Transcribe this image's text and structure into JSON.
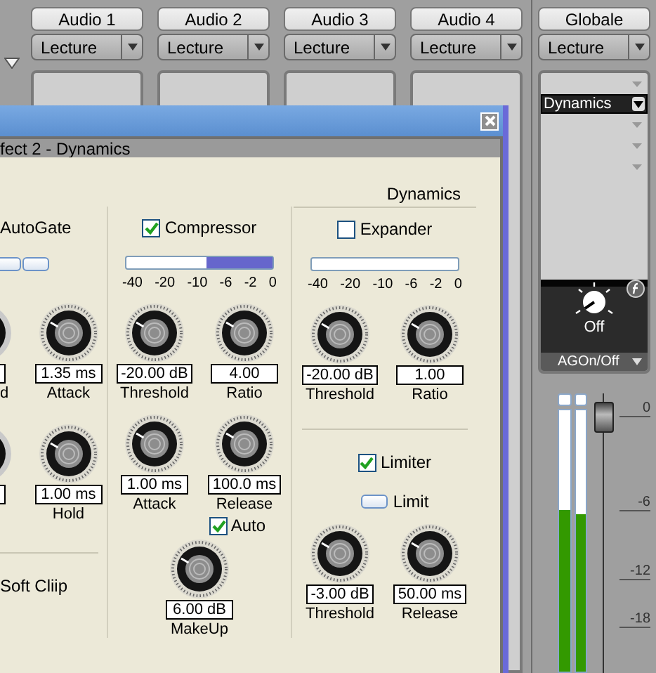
{
  "channels": [
    {
      "name": "Audio 1",
      "mode": "Lecture"
    },
    {
      "name": "Audio 2",
      "mode": "Lecture"
    },
    {
      "name": "Audio 3",
      "mode": "Lecture"
    },
    {
      "name": "Audio 4",
      "mode": "Lecture"
    }
  ],
  "global": {
    "name": "Globale",
    "mode": "Lecture",
    "insert": "Dynamics",
    "knob": {
      "reading": "Off"
    },
    "footer": "AGOn/Off",
    "meters": [
      {
        "level": 0.62
      },
      {
        "level": 0.6
      }
    ],
    "fader": {
      "level": 0.97,
      "scale": [
        "0",
        "-6",
        "-12",
        "-18"
      ]
    }
  },
  "window": {
    "title": "fect 2 - Dynamics",
    "heading": "Dynamics",
    "gate": {
      "label": "AutoGate",
      "rows": [
        [
          {
            "kind": "partial",
            "label": "d"
          },
          {
            "kind": "knob",
            "value": "1.35 ms",
            "label": "Attack"
          }
        ],
        [
          {
            "kind": "partial"
          },
          {
            "kind": "knob",
            "value": "1.00 ms",
            "label": "Hold"
          }
        ]
      ],
      "footer": "Soft Cliip"
    },
    "compressor": {
      "label": "Compressor",
      "checked": true,
      "meter": {
        "level": 0.45,
        "scale": [
          "-40",
          "-20",
          "-10",
          "-6",
          "-2",
          "0"
        ]
      },
      "rows": [
        [
          {
            "kind": "knob",
            "value": "-20.00 dB",
            "label": "Threshold"
          },
          {
            "kind": "knob",
            "value": "4.00",
            "label": "Ratio"
          }
        ],
        [
          {
            "kind": "knob",
            "value": "1.00 ms",
            "label": "Attack"
          },
          {
            "kind": "knob",
            "value": "100.0 ms",
            "label": "Release"
          }
        ]
      ],
      "auto": {
        "label": "Auto",
        "checked": true
      },
      "makeup": {
        "kind": "knob",
        "value": "6.00 dB",
        "label": "MakeUp"
      }
    },
    "expander": {
      "label": "Expander",
      "checked": false,
      "meter": {
        "scale": [
          "-40",
          "-20",
          "-10",
          "-6",
          "-2",
          "0"
        ]
      },
      "rows": [
        [
          {
            "kind": "knob",
            "value": "-20.00 dB",
            "label": "Threshold"
          },
          {
            "kind": "knob",
            "value": "1.00",
            "label": "Ratio"
          }
        ]
      ]
    },
    "limiter": {
      "label": "Limiter",
      "checked": true,
      "limit": "Limit",
      "rows": [
        [
          {
            "kind": "knob",
            "value": "-3.00 dB",
            "label": "Threshold"
          },
          {
            "kind": "knob",
            "value": "50.00 ms",
            "label": "Release"
          }
        ]
      ]
    }
  }
}
